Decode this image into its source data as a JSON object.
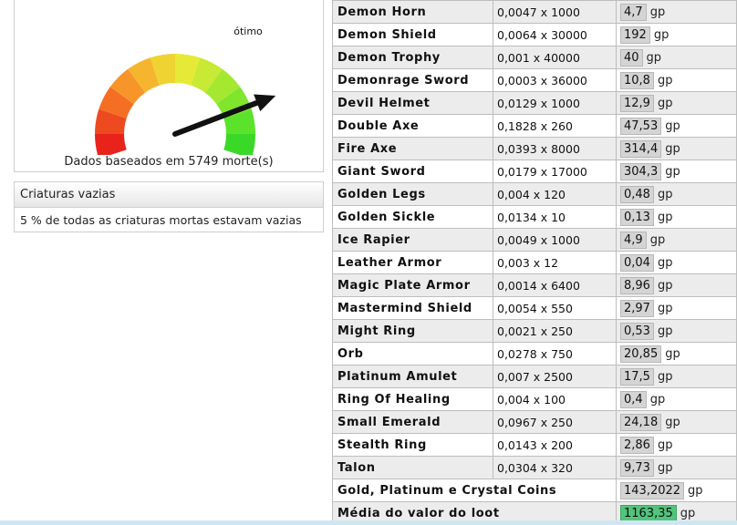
{
  "gauge": {
    "label": "ótimo",
    "caption": "Dados baseados em 5749 morte(s)",
    "level": 0.82
  },
  "empty_creatures": {
    "title": "Criaturas vazias",
    "text": "5 % de todas as criaturas mortas estavam vazias"
  },
  "loot": {
    "unit": "gp",
    "rows": [
      {
        "name": "Demon Horn",
        "calc": "0,0047 x 1000",
        "value": "4,7"
      },
      {
        "name": "Demon Shield",
        "calc": "0,0064 x 30000",
        "value": "192"
      },
      {
        "name": "Demon Trophy",
        "calc": "0,001 x 40000",
        "value": "40"
      },
      {
        "name": "Demonrage Sword",
        "calc": "0,0003 x 36000",
        "value": "10,8"
      },
      {
        "name": "Devil Helmet",
        "calc": "0,0129 x 1000",
        "value": "12,9"
      },
      {
        "name": "Double Axe",
        "calc": "0,1828 x 260",
        "value": "47,53"
      },
      {
        "name": "Fire Axe",
        "calc": "0,0393 x 8000",
        "value": "314,4"
      },
      {
        "name": "Giant Sword",
        "calc": "0,0179 x 17000",
        "value": "304,3"
      },
      {
        "name": "Golden Legs",
        "calc": "0,004 x 120",
        "value": "0,48"
      },
      {
        "name": "Golden Sickle",
        "calc": "0,0134 x 10",
        "value": "0,13"
      },
      {
        "name": "Ice Rapier",
        "calc": "0,0049 x 1000",
        "value": "4,9"
      },
      {
        "name": "Leather Armor",
        "calc": "0,003 x 12",
        "value": "0,04"
      },
      {
        "name": "Magic Plate Armor",
        "calc": "0,0014 x 6400",
        "value": "8,96"
      },
      {
        "name": "Mastermind Shield",
        "calc": "0,0054 x 550",
        "value": "2,97"
      },
      {
        "name": "Might Ring",
        "calc": "0,0021 x 250",
        "value": "0,53"
      },
      {
        "name": "Orb",
        "calc": "0,0278 x 750",
        "value": "20,85"
      },
      {
        "name": "Platinum Amulet",
        "calc": "0,007 x 2500",
        "value": "17,5"
      },
      {
        "name": "Ring Of Healing",
        "calc": "0,004 x 100",
        "value": "0,4"
      },
      {
        "name": "Small Emerald",
        "calc": "0,0967 x 250",
        "value": "24,18"
      },
      {
        "name": "Stealth Ring",
        "calc": "0,0143 x 200",
        "value": "2,86"
      },
      {
        "name": "Talon",
        "calc": "0,0304 x 320",
        "value": "9,73"
      }
    ],
    "coins": {
      "label": "Gold, Platinum e Crystal Coins",
      "value": "143,2022"
    },
    "average": {
      "label": "Média do valor do loot",
      "value": "1163,35"
    }
  },
  "colors": {
    "highlight": "#52c47c",
    "value_box": "#d4d4d4",
    "gauge_colors": [
      "#e8231c",
      "#ee4a1f",
      "#f46f23",
      "#f7942a",
      "#f6b52e",
      "#eed332",
      "#e6ea36",
      "#c8ea34",
      "#a4e830",
      "#80e52d",
      "#5be22a",
      "#3ad927"
    ]
  }
}
